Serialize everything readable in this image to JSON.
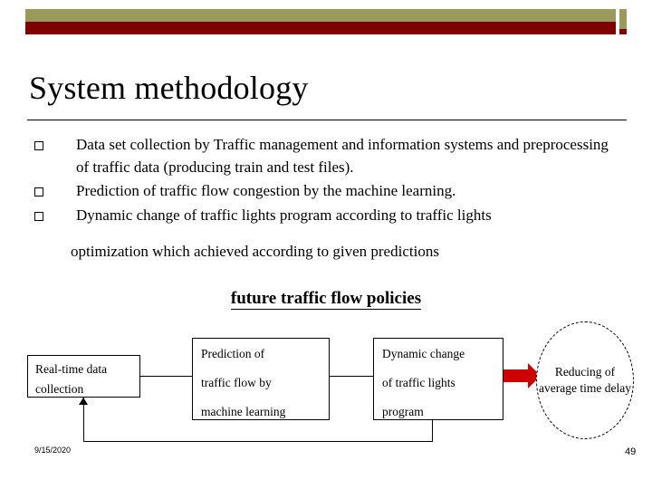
{
  "slide": {
    "title": "System methodology",
    "bullets": [
      "Data set collection by Traffic management and information systems and preprocessing of traffic data (producing train and test files).",
      "Prediction of  traffic flow congestion by the machine learning.",
      "Dynamic change of traffic lights program according to traffic lights"
    ],
    "continuation": "optimization which achieved according to given predictions",
    "diagram_heading": "future traffic flow policies"
  },
  "diagram": {
    "boxes": [
      {
        "id": "realtime",
        "line1": "Real-time data",
        "line2": "collection"
      },
      {
        "id": "prediction",
        "line1": "Prediction of",
        "line2": "traffic flow by",
        "line3": "machine learning"
      },
      {
        "id": "dynamic",
        "line1": "Dynamic change",
        "line2": "of traffic lights",
        "line3": "program"
      }
    ],
    "outcome": "Reducing of average time delay",
    "arrow_color": "#cc0000"
  },
  "footer": {
    "date": "9/15/2020",
    "page_number": "49"
  },
  "theme": {
    "bar_olive": "#9a9a5c",
    "bar_dark_red": "#7e0000",
    "text": "#000000",
    "background": "#ffffff"
  }
}
